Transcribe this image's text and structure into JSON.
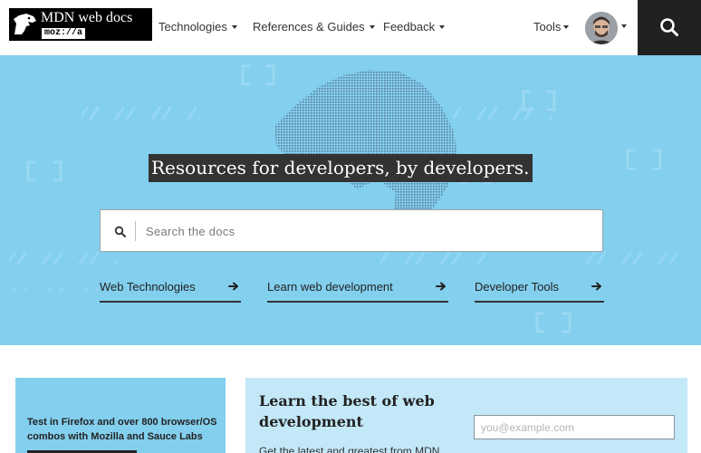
{
  "header": {
    "logo": {
      "title": "MDN web docs",
      "subtitle": "moz://a"
    },
    "nav": [
      {
        "label": "Technologies"
      },
      {
        "label": "References & Guides"
      },
      {
        "label": "Feedback"
      }
    ],
    "tools_label": "Tools",
    "colors": {
      "search_button_bg": "#212121",
      "logo_bg": "#000000"
    }
  },
  "hero": {
    "title": "Resources for developers, by developers.",
    "search": {
      "placeholder": "Search the docs",
      "value": ""
    },
    "links": [
      {
        "label": "Web Technologies"
      },
      {
        "label": "Learn web development"
      },
      {
        "label": "Developer Tools"
      }
    ],
    "colors": {
      "background": "#83cfee",
      "title_bg": "#333333"
    }
  },
  "promo": {
    "text": "Test in Firefox and over 800 browser/OS combos with Mozilla and Sauce Labs"
  },
  "newsletter": {
    "title": "Learn the best of web development",
    "description": "Get the latest and greatest from MDN",
    "email_placeholder": "you@example.com",
    "email_value": "",
    "colors": {
      "background": "#c3e8f8"
    }
  }
}
